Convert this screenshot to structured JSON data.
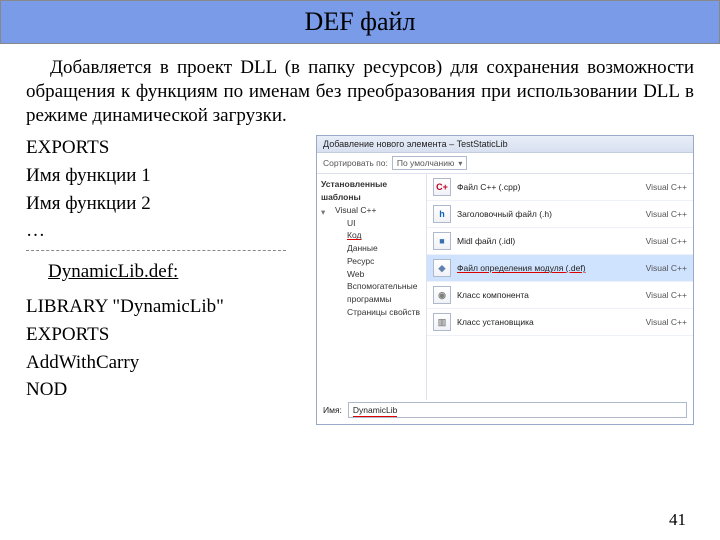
{
  "header": {
    "title": "DEF файл"
  },
  "paragraph": "Добавляется в проект DLL (в папку ресурсов) для сохранения возможности обращения к функциям по именам без преобразования при использовании DLL в режиме динамической загрузки.",
  "syntax": {
    "exports_kw": "EXPORTS",
    "fn1": "Имя функции 1",
    "fn2": "Имя функции 2",
    "ellipsis": "…"
  },
  "def_file": {
    "title": "DynamicLib.def:",
    "library_line": "LIBRARY      \"DynamicLib\"",
    "exports_kw": "EXPORTS",
    "fn1": "AddWithCarry",
    "fn2": "NOD"
  },
  "dialog": {
    "title": "Добавление нового элемента – TestStaticLib",
    "sort_label": "Сортировать по:",
    "sort_value": "По умолчанию",
    "tree": {
      "root": "Установленные шаблоны",
      "items": [
        {
          "label": "Visual C++",
          "expandable": true
        },
        {
          "label": "UI",
          "indent": true
        },
        {
          "label": "Код",
          "indent": true,
          "selected": true
        },
        {
          "label": "Данные",
          "indent": true
        },
        {
          "label": "Ресурс",
          "indent": true
        },
        {
          "label": "Web",
          "indent": true
        },
        {
          "label": "Вспомогательные программы",
          "indent": true
        },
        {
          "label": "Страницы свойств",
          "indent": true
        }
      ]
    },
    "items": [
      {
        "icon": "cpp",
        "glyph": "C+",
        "color": "#c00020",
        "label": "Файл C++ (.cpp)",
        "category": "Visual C++"
      },
      {
        "icon": "h",
        "glyph": "h",
        "color": "#1060c0",
        "label": "Заголовочный файл (.h)",
        "category": "Visual C++"
      },
      {
        "icon": "idl",
        "glyph": "■",
        "color": "#3a70b0",
        "label": "Midl файл (.idl)",
        "category": "Visual C++"
      },
      {
        "icon": "def",
        "glyph": "◆",
        "color": "#6080b0",
        "label": "Файл определения модуля (.def)",
        "category": "Visual C++",
        "selected": true
      },
      {
        "icon": "cmp",
        "glyph": "◉",
        "color": "#808080",
        "label": "Класс компонента",
        "category": "Visual C++"
      },
      {
        "icon": "ins",
        "glyph": "▥",
        "color": "#909090",
        "label": "Класс установщика",
        "category": "Visual C++"
      }
    ],
    "name_label": "Имя:",
    "name_value": "DynamicLib"
  },
  "page_number": "41"
}
